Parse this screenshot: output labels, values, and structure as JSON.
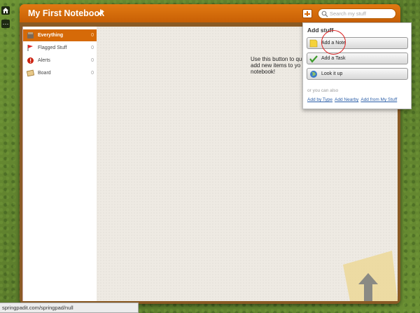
{
  "rail": {
    "home_icon": "home-icon",
    "more_label": "⋯"
  },
  "notebook": {
    "title": "My First Notebook",
    "accent_color": "#d66a08"
  },
  "search": {
    "placeholder": "Search my stuff"
  },
  "sidebar": {
    "items": [
      {
        "label": "Everything",
        "count": "0",
        "icon": "everything-icon",
        "active": true
      },
      {
        "label": "Flagged Stuff",
        "count": "0",
        "icon": "flag-icon"
      },
      {
        "label": "Alerts",
        "count": "0",
        "icon": "alert-icon"
      },
      {
        "label": "Board",
        "count": "0",
        "icon": "board-icon"
      }
    ]
  },
  "page": {
    "hint_lines": [
      "Use this button to qu",
      "add new items to yo",
      "notebook!"
    ]
  },
  "popup": {
    "title": "Add stuff",
    "buttons": [
      {
        "label": "Add a Note",
        "icon": "note-icon"
      },
      {
        "label": "Add a Task",
        "icon": "checkmark-icon"
      },
      {
        "label": "Look it up",
        "icon": "globe-icon"
      }
    ],
    "subtext": "or you can also",
    "links": [
      "Add by Type",
      "Add Nearby",
      "Add from My Stuff"
    ]
  },
  "status_bar": {
    "text": "springpadit.com/springpad/null"
  }
}
